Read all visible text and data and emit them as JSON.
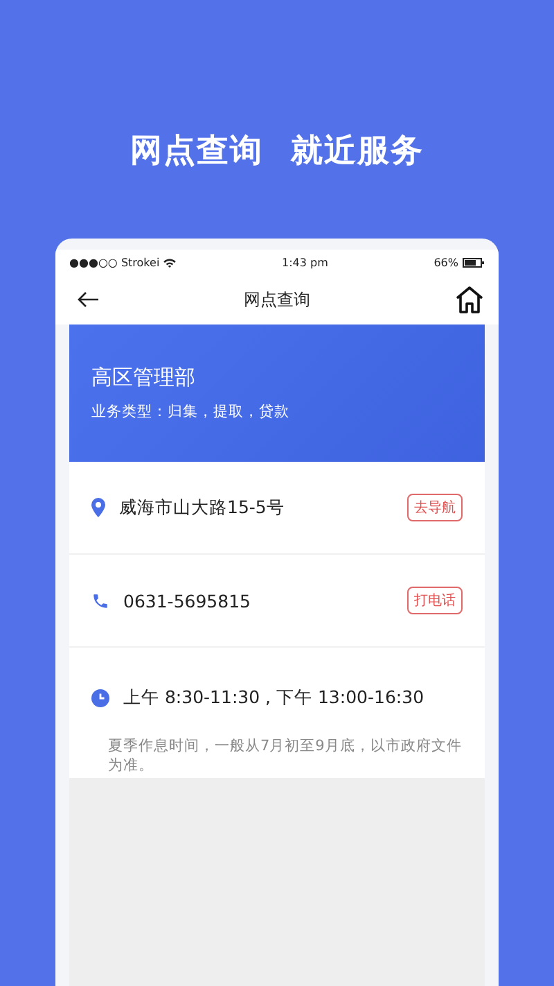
{
  "headline": [
    "网点查询",
    "就近服务"
  ],
  "status_bar": {
    "carrier": "●●●○○ Strokei",
    "time": "1:43 pm",
    "battery": "66%"
  },
  "nav": {
    "title": "网点查询"
  },
  "branch": {
    "name": "高区管理部",
    "services": "业务类型：归集，提取，贷款"
  },
  "rows": [
    {
      "kind": "address",
      "text": "威海市山大路15-5号",
      "action": "去导航"
    },
    {
      "kind": "phone",
      "text": "0631-5695815",
      "action": "打电话"
    }
  ],
  "hours": {
    "text": "上午 8:30-11:30 , 下午 13:00-16:30",
    "note": "夏季作息时间，一般从7月初至9月底，以市政府文件为准。"
  }
}
